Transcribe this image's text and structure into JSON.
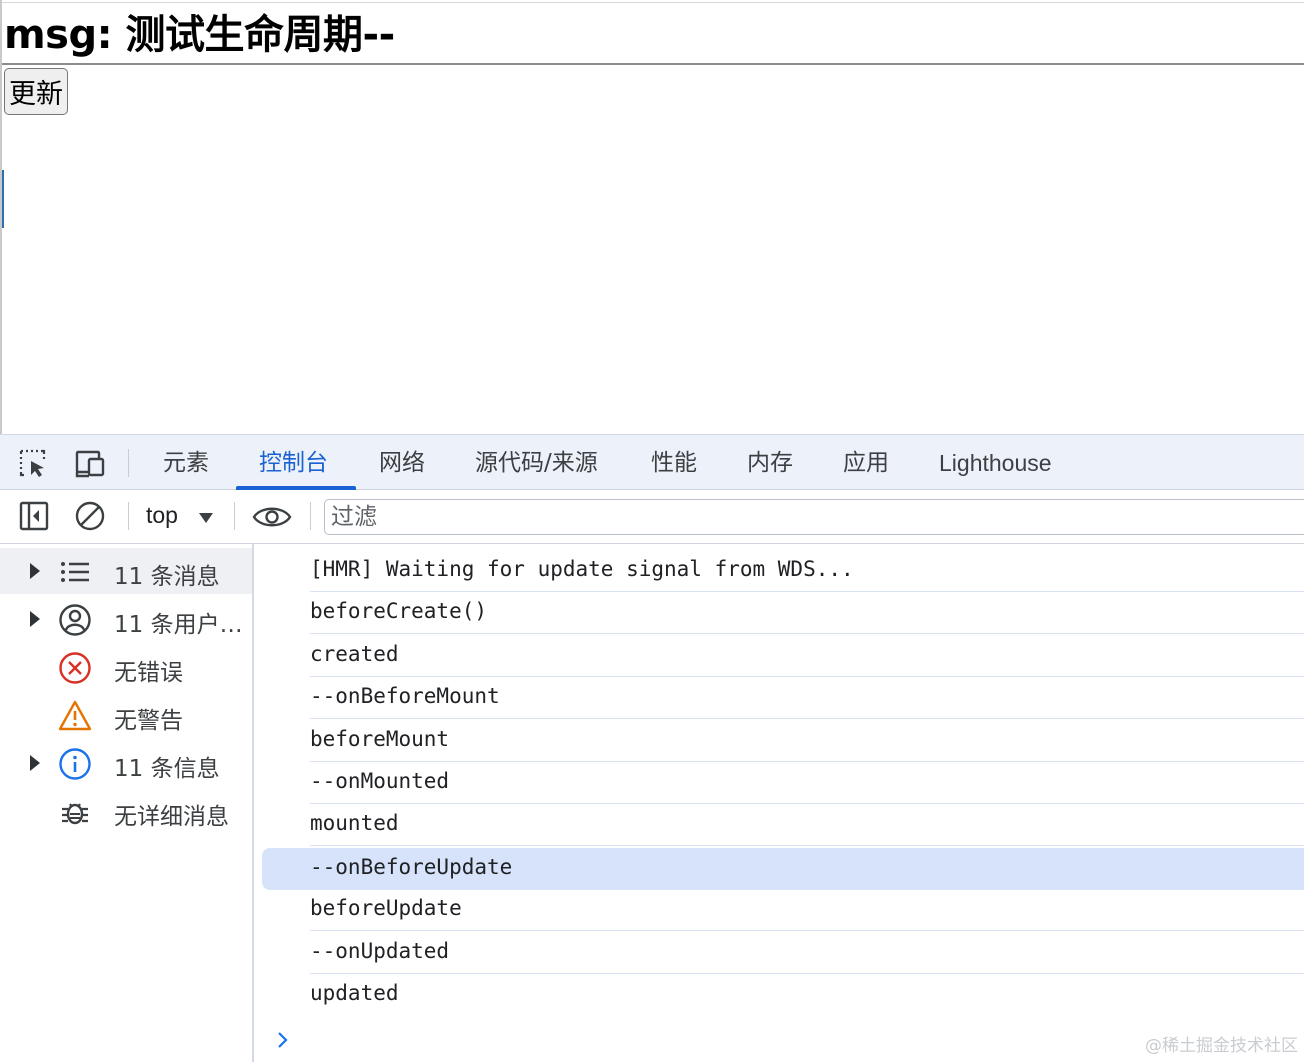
{
  "page": {
    "heading": "msg: 测试生命周期--",
    "update_button": "更新"
  },
  "devtools": {
    "tabs": [
      {
        "label": "元素",
        "active": false
      },
      {
        "label": "控制台",
        "active": true
      },
      {
        "label": "网络",
        "active": false
      },
      {
        "label": "源代码/来源",
        "active": false
      },
      {
        "label": "性能",
        "active": false
      },
      {
        "label": "内存",
        "active": false
      },
      {
        "label": "应用",
        "active": false
      },
      {
        "label": "Lighthouse",
        "active": false
      }
    ],
    "toolbar": {
      "context": "top",
      "filter_placeholder": "过滤"
    },
    "sidebar": [
      {
        "label": "11 条消息",
        "icon": "list-icon",
        "expandable": true,
        "selected": true
      },
      {
        "label": "11 条用户…",
        "icon": "user-icon",
        "expandable": true,
        "selected": false
      },
      {
        "label": "无错误",
        "icon": "error-icon",
        "expandable": false,
        "selected": false
      },
      {
        "label": "无警告",
        "icon": "warning-icon",
        "expandable": false,
        "selected": false
      },
      {
        "label": "11 条信息",
        "icon": "info-icon",
        "expandable": true,
        "selected": false
      },
      {
        "label": "无详细消息",
        "icon": "bug-icon",
        "expandable": false,
        "selected": false
      }
    ],
    "log": [
      "[HMR] Waiting for update signal from WDS...",
      "beforeCreate()",
      "created",
      "--onBeforeMount",
      "beforeMount",
      "--onMounted",
      "mounted",
      "--onBeforeUpdate",
      "beforeUpdate",
      "--onUpdated",
      "updated"
    ],
    "highlighted_log_index": 7
  },
  "watermark": "@稀土掘金技术社区",
  "colors": {
    "accent": "#1a62d3",
    "tabbar_bg": "#edf2fa",
    "highlight_row": "#d6e3fb",
    "error": "#d93025",
    "warning": "#e37400",
    "info": "#1a73e8"
  }
}
